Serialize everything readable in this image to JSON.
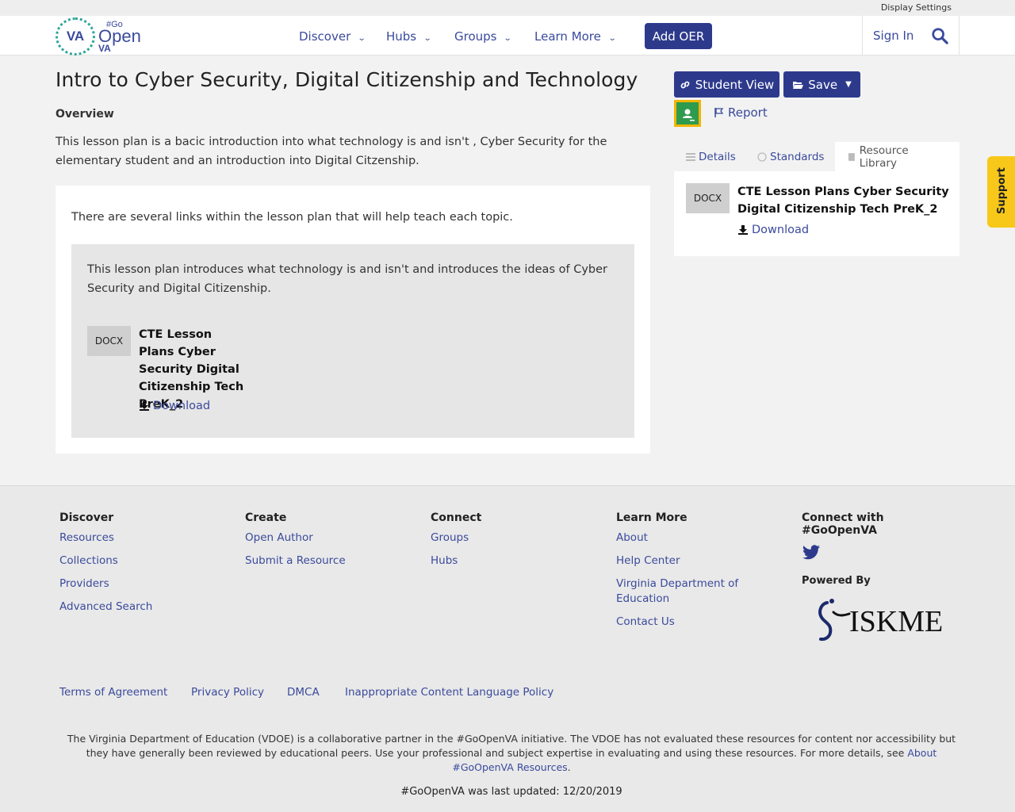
{
  "topbar": {
    "display_settings": "Display Settings"
  },
  "header": {
    "logo": {
      "va": "VA",
      "go": "#Go",
      "open": "Open",
      "va_sub": "VA"
    },
    "nav": [
      "Discover",
      "Hubs",
      "Groups",
      "Learn More"
    ],
    "add_oer": "Add OER",
    "sign_in": "Sign In"
  },
  "main": {
    "title": "Intro to Cyber Security, Digital Citizenship and Technology",
    "overview_label": "Overview",
    "overview_text": "This lesson plan is a bacic introduction into what technology is and isn't , Cyber Security for the elementary student and an introduction into Digital Citzenship.",
    "links_text": "There are several links within the lesson  plan that will help teach each topic.",
    "box_text": "This lesson plan introduces what technology is and isn't and introduces the ideas of Cyber Security and Digital Citizenship.",
    "file": {
      "type": "DOCX",
      "title": "CTE Lesson Plans Cyber Security Digital Citizenship Tech PreK_2",
      "download": "Download"
    }
  },
  "sidebar": {
    "student_view": "Student View",
    "save": "Save",
    "report": "Report",
    "tabs": [
      "Details",
      "Standards",
      "Resource Library"
    ],
    "active_tab": "Resource Library",
    "file": {
      "type": "DOCX",
      "title": "CTE Lesson Plans Cyber Security Digital Citizenship Tech PreK_2",
      "download": "Download"
    }
  },
  "support": "Support",
  "footer": {
    "columns": [
      {
        "heading": "Discover",
        "links": [
          "Resources",
          "Collections",
          "Providers",
          "Advanced Search"
        ]
      },
      {
        "heading": "Create",
        "links": [
          "Open Author",
          "Submit a Resource"
        ]
      },
      {
        "heading": "Connect",
        "links": [
          "Groups",
          "Hubs"
        ]
      },
      {
        "heading": "Learn More",
        "links": [
          "About",
          "Help Center",
          "Virginia Department of Education",
          "Contact Us"
        ]
      }
    ],
    "connect_heading": "Connect with #GoOpenVA",
    "powered_by": "Powered By",
    "iskme": "ISKME",
    "legal": [
      "Terms of Agreement",
      "Privacy Policy",
      "DMCA",
      "Inappropriate Content Language Policy"
    ],
    "disclaimer": "The Virginia Department of Education (VDOE) is a collaborative partner in the #GoOpenVA initiative. The VDOE has not evaluated these resources for content nor accessibility but they have generally been reviewed by educational peers. Use your professional and subject expertise in evaluating and using these resources. For more details, see ",
    "disclaimer_link": "About #GoOpenVA Resources",
    "disclaimer_end": ".",
    "last_updated": "#GoOpenVA was last updated: 12/20/2019"
  },
  "colors": {
    "brand": "#2d3a8c",
    "link": "#3a4a9c",
    "support": "#f7c81a",
    "classroom": "#2e9b4f"
  }
}
